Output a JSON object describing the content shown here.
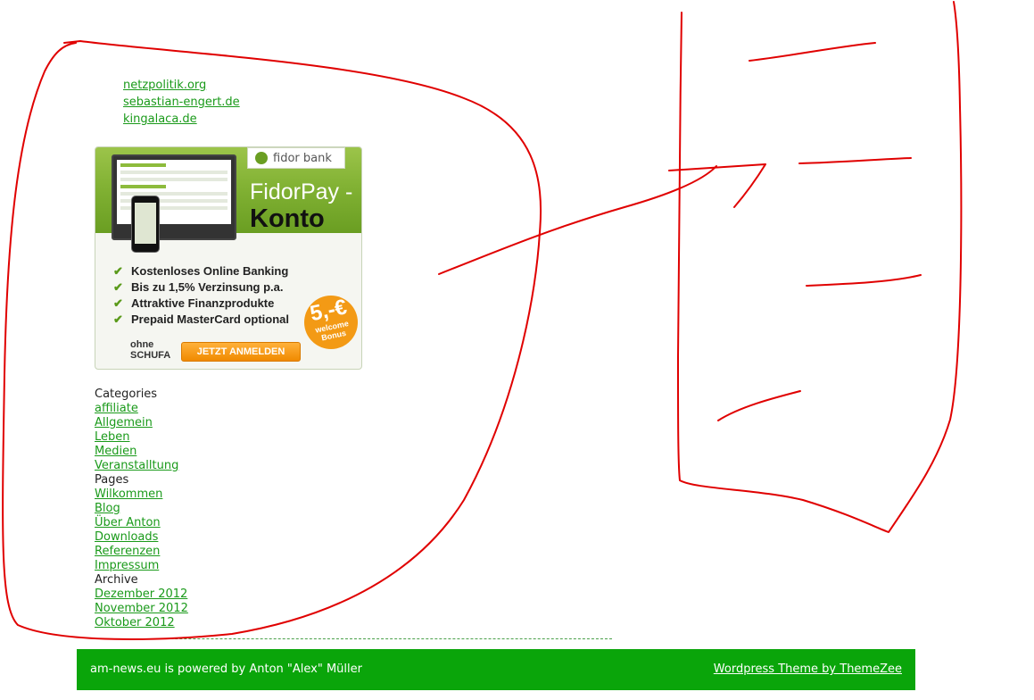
{
  "blogroll": {
    "links": [
      "netzpolitik.org",
      "sebastian-engert.de",
      "kingalaca.de"
    ]
  },
  "ad": {
    "logo_text": "fidor bank",
    "title_line1": "FidorPay -",
    "title_line2": "Konto",
    "features": [
      "Kostenloses Online Banking",
      "Bis zu 1,5% Verzinsung p.a.",
      "Attraktive Finanzprodukte",
      "Prepaid MasterCard optional"
    ],
    "badge_amount": "5,-€",
    "badge_text": "welcome Bonus",
    "ohne_line1": "ohne",
    "ohne_line2": "SCHUFA",
    "cta_label": "JETZT ANMELDEN",
    "accent_color": "#7fb02e",
    "cta_color": "#f39a15"
  },
  "categories": {
    "heading": "Categories",
    "items": [
      "affiliate",
      "Allgemein",
      "Leben",
      "Medien",
      "Veranstalltung"
    ]
  },
  "pages": {
    "heading": "Pages",
    "items": [
      "Wilkommen",
      "Blog",
      "Über Anton",
      "Downloads",
      "Referenzen",
      "Impressum"
    ]
  },
  "archive": {
    "heading": "Archive",
    "items": [
      "Dezember 2012",
      "November 2012",
      "Oktober 2012"
    ]
  },
  "footer": {
    "credit": "am-news.eu is powered by Anton \"Alex\" Müller",
    "theme_link": "Wordpress Theme by ThemeZee",
    "bg_color": "#0aa50a"
  },
  "annotation": {
    "stroke_color": "#e00000",
    "description_shapes": [
      "scribble-loop",
      "pointer-line",
      "letter-E"
    ]
  }
}
